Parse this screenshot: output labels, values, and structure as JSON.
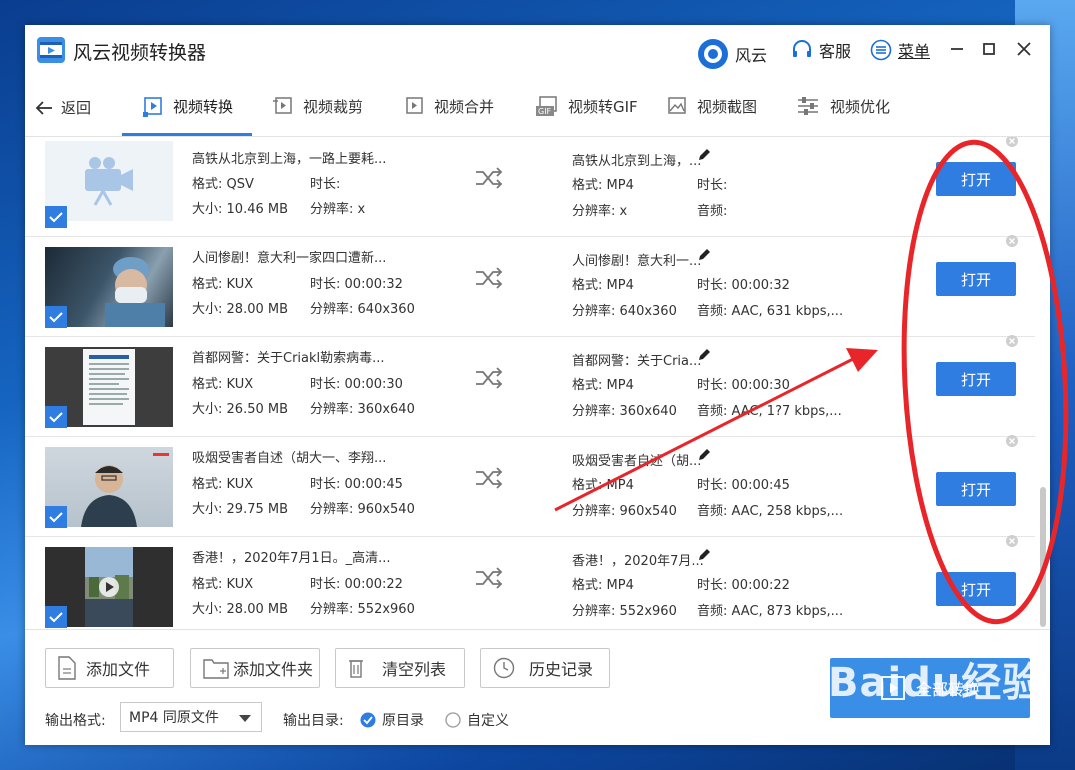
{
  "app": {
    "title": "风云视频转换器"
  },
  "titlebar": {
    "brand": "风云",
    "service": "客服",
    "menu": "菜单"
  },
  "nav": {
    "back": "返回",
    "tabs": [
      "视频转换",
      "视频裁剪",
      "视频合并",
      "视频转GIF",
      "视频截图",
      "视频优化"
    ]
  },
  "labels": {
    "format": "格式:",
    "duration": "时长:",
    "size": "大小:",
    "resolution": "分辨率:",
    "audio": "音频:"
  },
  "rows": [
    {
      "src_name": "高铁从北京到上海，一路上要耗...",
      "src_format": "QSV",
      "src_duration": "",
      "src_size": "10.46 MB",
      "src_res": "x",
      "out_name": "高铁从北京到上海，...",
      "out_format": "MP4",
      "out_duration": "",
      "out_res": "x",
      "out_audio": "",
      "open": "打开",
      "thumb": "video-placeholder"
    },
    {
      "src_name": "人间惨剧！意大利一家四口遭新...",
      "src_format": "KUX",
      "src_duration": "00:00:32",
      "src_size": "28.00 MB",
      "src_res": "640x360",
      "out_name": "人间惨剧！意大利一...",
      "out_format": "MP4",
      "out_duration": "00:00:32",
      "out_res": "640x360",
      "out_audio": "AAC, 631 kbps,...",
      "open": "打开",
      "thumb": "surgeon"
    },
    {
      "src_name": "首都网警：关于Criakl勒索病毒...",
      "src_format": "KUX",
      "src_duration": "00:00:30",
      "src_size": "26.50 MB",
      "src_res": "360x640",
      "out_name": "首都网警：关于Cria...",
      "out_format": "MP4",
      "out_duration": "00:00:30",
      "out_res": "360x640",
      "out_audio": "AAC, 1?7 kbps,...",
      "open": "打开",
      "thumb": "document"
    },
    {
      "src_name": "吸烟受害者自述（胡大一、李翔...",
      "src_format": "KUX",
      "src_duration": "00:00:45",
      "src_size": "29.75 MB",
      "src_res": "960x540",
      "out_name": "吸烟受害者自述（胡...",
      "out_format": "MP4",
      "out_duration": "00:00:45",
      "out_res": "960x540",
      "out_audio": "AAC, 258 kbps,...",
      "open": "打开",
      "thumb": "speaker"
    },
    {
      "src_name": "香港！，2020年7月1日。_高清...",
      "src_format": "KUX",
      "src_duration": "00:00:22",
      "src_size": "28.00 MB",
      "src_res": "552x960",
      "out_name": "香港！，2020年7月...",
      "out_format": "MP4",
      "out_duration": "00:00:22",
      "out_res": "552x960",
      "out_audio": "AAC, 873 kbps,...",
      "open": "打开",
      "thumb": "street"
    }
  ],
  "bottom": {
    "add_file": "添加文件",
    "add_folder": "添加文件夹",
    "clear_list": "清空列表",
    "history": "历史记录",
    "convert_all": "全部转换",
    "output_format_label": "输出格式:",
    "output_format_value": "MP4 同原文件",
    "output_dir_label": "输出目录:",
    "dir_original": "原目录",
    "dir_custom": "自定义"
  },
  "watermark": {
    "main": "Baidu经验",
    "sub": "jingyan.baidu.com"
  },
  "colors": {
    "accent": "#2f7de1",
    "annotation": "#e8262a"
  }
}
